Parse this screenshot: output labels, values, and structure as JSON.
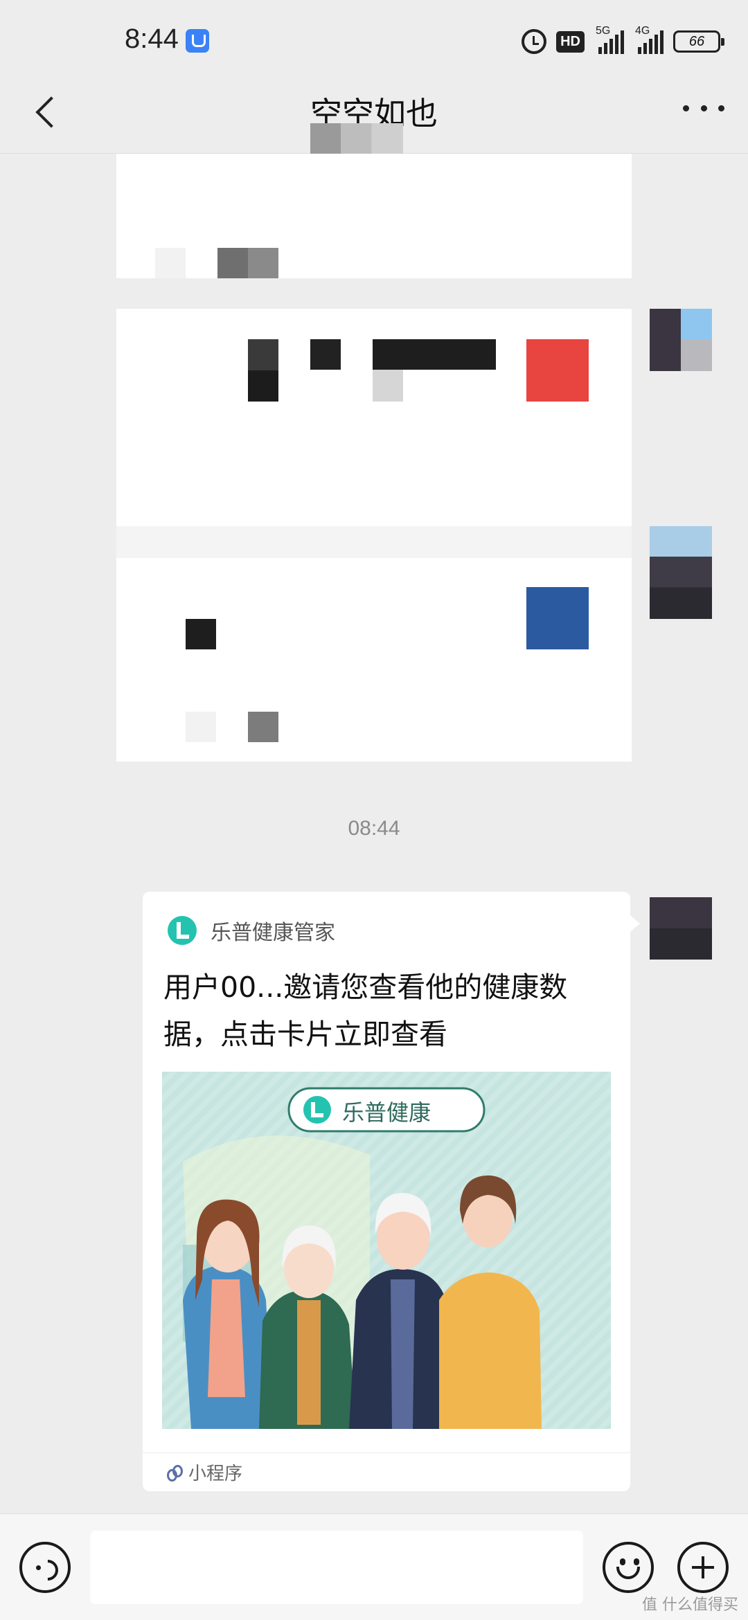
{
  "status_bar": {
    "time": "8:44",
    "hd_label": "HD",
    "network_1": "5G",
    "network_2": "4G",
    "battery": "66"
  },
  "header": {
    "title": "空空如也"
  },
  "chat": {
    "timestamp": "08:44",
    "card": {
      "app_name": "乐普健康管家",
      "message": "用户00...邀请您查看他的健康数据，点击卡片立即查看",
      "image_badge": "乐普健康",
      "footer_label": "小程序"
    }
  },
  "input": {
    "placeholder": ""
  },
  "watermark": "值 什么值得买",
  "colors": {
    "background": "#ededed",
    "bubble": "#ffffff",
    "brand_teal": "#24c3b0",
    "accent_red": "#e84440",
    "accent_blue": "#2b5aa0"
  }
}
